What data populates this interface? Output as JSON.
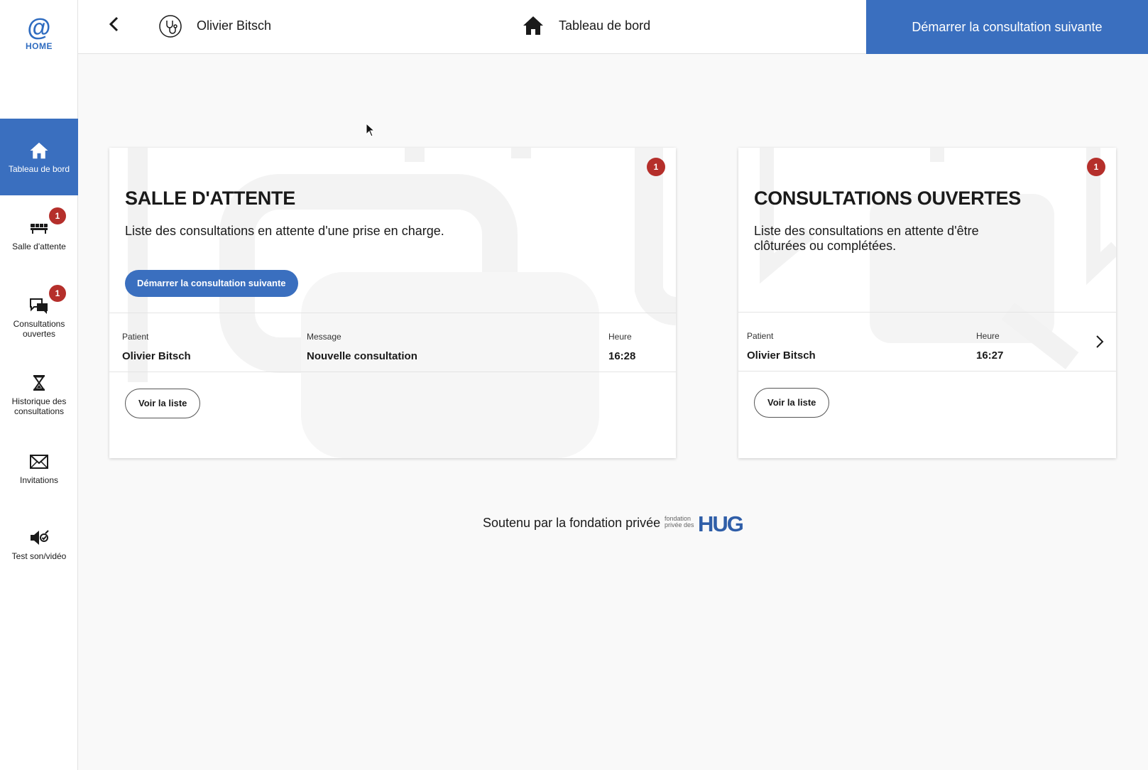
{
  "app": {
    "logo_symbol": "@",
    "logo_text": "HOME",
    "accent_color": "#3a6fbf",
    "badge_color": "#b52f2b"
  },
  "sidebar": {
    "items": [
      {
        "label": "Tableau de bord",
        "icon": "home-icon",
        "active": true
      },
      {
        "label": "Salle d'attente",
        "icon": "waiting-room-icon",
        "badge": "1"
      },
      {
        "label": "Consultations ouvertes",
        "icon": "chat-bubbles-icon",
        "badge": "1"
      },
      {
        "label": "Historique des consultations",
        "icon": "hourglass-icon"
      },
      {
        "label": "Invitations",
        "icon": "envelope-icon"
      },
      {
        "label": "Test son/vidéo",
        "icon": "speaker-check-icon"
      }
    ]
  },
  "header": {
    "back_icon": "chevron-left-icon",
    "user_icon": "stethoscope-icon",
    "user_name": "Olivier Bitsch",
    "page_icon": "home-icon",
    "page_title": "Tableau de bord",
    "cta_label": "Démarrer la consultation suivante"
  },
  "waiting_room": {
    "badge": "1",
    "title": "SALLE D'ATTENTE",
    "description": "Liste des consultations en attente d'une prise en charge.",
    "start_label": "Démarrer la consultation suivante",
    "columns": {
      "patient": "Patient",
      "message": "Message",
      "time": "Heure"
    },
    "rows": [
      {
        "patient": "Olivier Bitsch",
        "message": "Nouvelle consultation",
        "time": "16:28"
      }
    ],
    "view_list_label": "Voir la liste"
  },
  "open_consultations": {
    "badge": "1",
    "title": "CONSULTATIONS OUVERTES",
    "description": "Liste des consultations en attente d'être clôturées ou complétées.",
    "columns": {
      "patient": "Patient",
      "time": "Heure"
    },
    "rows": [
      {
        "patient": "Olivier Bitsch",
        "time": "16:27"
      }
    ],
    "view_list_label": "Voir la liste"
  },
  "footer": {
    "text": "Soutenu par la fondation privée",
    "logo_small_line1": "fondation",
    "logo_small_line2": "privée des",
    "logo_mark": "HUG"
  }
}
